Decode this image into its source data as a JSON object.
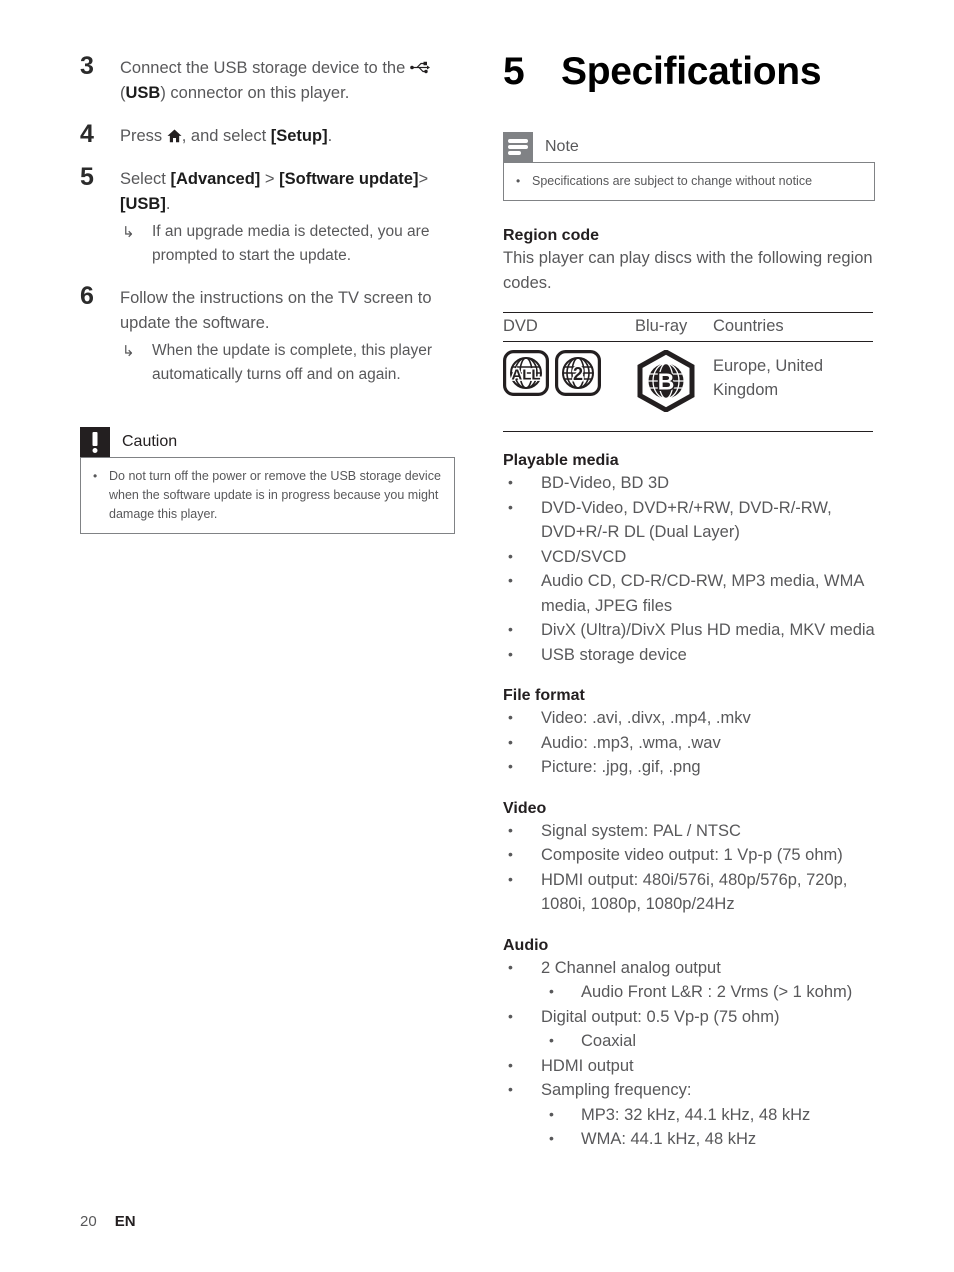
{
  "colors": {
    "body_text": "#58585a",
    "heading_text": "#231f20",
    "note_badge": "#808285",
    "caution_badge": "#231f20",
    "rule": "#231f20"
  },
  "left_column": {
    "steps": [
      {
        "number": "3",
        "text_before_icon": "Connect the USB storage device to the ",
        "icon": "usb-icon",
        "text_after_icon": " (USB) connector on this player.",
        "plain": "Connect the USB storage device to the  (USB) connector on this player."
      },
      {
        "number": "4",
        "plain": "Press , and select [Setup]."
      },
      {
        "number": "5",
        "plain": "Select [Advanced] > [Software update]> [USB]."
      },
      {
        "number": "6",
        "plain": "Follow the instructions on the TV screen to update the software."
      }
    ],
    "step3_usb_label": "USB",
    "step4_prefix": "Press ",
    "step4_middle": ", and select ",
    "step4_bold": "[Setup]",
    "step4_suffix": ".",
    "step5_prefix": "Select ",
    "step5_bold1": "[Advanced]",
    "step5_sep": " > ",
    "step5_bold2": "[Software update]",
    "step5_gt": ">",
    "step5_bold3": "[USB]",
    "step5_suffix": ".",
    "step5_subnote": "If an upgrade media is detected, you are prompted to start the update.",
    "step6_text": "Follow the instructions on the TV screen to update the software.",
    "step6_subnote": "When the update is complete, this player automatically turns off and on again.",
    "arrow_glyph": "↳",
    "caution": {
      "title": "Caution",
      "badge_icon": "exclamation-icon",
      "items": [
        "Do not turn off the power or remove the USB storage device when the software update is in progress because you might damage this player."
      ],
      "bullet": "•"
    }
  },
  "right_column": {
    "chapter": {
      "number": "5",
      "title": "Specifications"
    },
    "note": {
      "title": "Note",
      "badge_icon": "note-lines-icon",
      "items": [
        "Specifications are subject to change without notice"
      ],
      "bullet": "•"
    },
    "region_code": {
      "heading": "Region code",
      "paragraph": "This player can play discs with the following region codes.",
      "table": {
        "headers": [
          "DVD",
          "Blu-ray",
          "Countries"
        ],
        "row": {
          "dvd_icons": [
            "dvd-region-all-icon",
            "dvd-region-2-icon"
          ],
          "dvd_icon_labels": [
            "ALL",
            "2"
          ],
          "bluray_icon": "bluray-region-b-icon",
          "bluray_icon_label": "B",
          "countries": "Europe, United Kingdom"
        }
      }
    },
    "sections": [
      {
        "heading": "Playable media",
        "bullet": "•",
        "items": [
          {
            "text": "BD-Video, BD 3D"
          },
          {
            "text": "DVD-Video, DVD+R/+RW, DVD-R/-RW, DVD+R/-R DL (Dual Layer)"
          },
          {
            "text": "VCD/SVCD"
          },
          {
            "text": "Audio CD, CD-R/CD-RW, MP3 media, WMA media, JPEG files"
          },
          {
            "text": "DivX (Ultra)/DivX Plus HD media, MKV media"
          },
          {
            "text": "USB storage device"
          }
        ]
      },
      {
        "heading": "File format",
        "bullet": "•",
        "items": [
          {
            "text": "Video: .avi, .divx, .mp4, .mkv"
          },
          {
            "text": "Audio: .mp3, .wma, .wav"
          },
          {
            "text": "Picture: .jpg, .gif, .png"
          }
        ]
      },
      {
        "heading": "Video",
        "bullet": "•",
        "items": [
          {
            "text": "Signal system: PAL / NTSC"
          },
          {
            "text": "Composite video output: 1 Vp-p (75 ohm)"
          },
          {
            "text": "HDMI output: 480i/576i, 480p/576p, 720p, 1080i, 1080p, 1080p/24Hz"
          }
        ]
      },
      {
        "heading": "Audio",
        "bullet": "•",
        "items": [
          {
            "text": "2 Channel analog output",
            "sub": [
              "Audio Front L&R : 2 Vrms (> 1 kohm)"
            ]
          },
          {
            "text": "Digital output: 0.5 Vp-p (75 ohm)",
            "sub": [
              "Coaxial"
            ]
          },
          {
            "text": "HDMI output"
          },
          {
            "text": "Sampling frequency:",
            "sub": [
              "MP3: 32 kHz, 44.1 kHz, 48 kHz",
              "WMA: 44.1 kHz, 48 kHz"
            ]
          }
        ]
      }
    ]
  },
  "footer": {
    "page_number": "20",
    "language": "EN"
  }
}
